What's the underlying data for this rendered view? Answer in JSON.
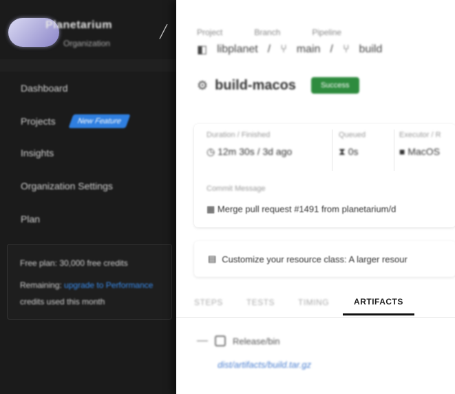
{
  "sidebar": {
    "org_name": "Planetarium",
    "org_sub": "Organization",
    "nav": [
      {
        "label": "Dashboard"
      },
      {
        "label": "Projects",
        "badge": "New Feature"
      },
      {
        "label": "Insights"
      },
      {
        "label": "Organization Settings"
      },
      {
        "label": "Plan"
      }
    ],
    "plan": {
      "line1": "Free plan: 30,000 free credits",
      "line2_prefix": "Remaining:",
      "line2_link": "upgrade to Performance",
      "line3": "credits used this month"
    }
  },
  "main": {
    "breadcrumb_labels": [
      "Project",
      "Branch",
      "Pipeline"
    ],
    "crumbs": [
      "libplanet",
      "main",
      "build"
    ],
    "title": "build-macos",
    "status": "Success",
    "info": {
      "duration_label": "Duration / Finished",
      "duration_value": "12m 30s / 3d ago",
      "queued_label": "Queued",
      "queued_value": "0s",
      "executor_label": "Executor / R",
      "executor_value": "MacOS",
      "commit_label": "Commit Message",
      "commit_value": "Merge pull request #1491 from planetarium/d"
    },
    "notice": "Customize your resource class: A larger resour",
    "tabs": [
      "STEPS",
      "TESTS",
      "TIMING",
      "ARTIFACTS"
    ],
    "artifact_folder": "Release/bin",
    "artifact_link": "dist/artifacts/build.tar.gz"
  }
}
